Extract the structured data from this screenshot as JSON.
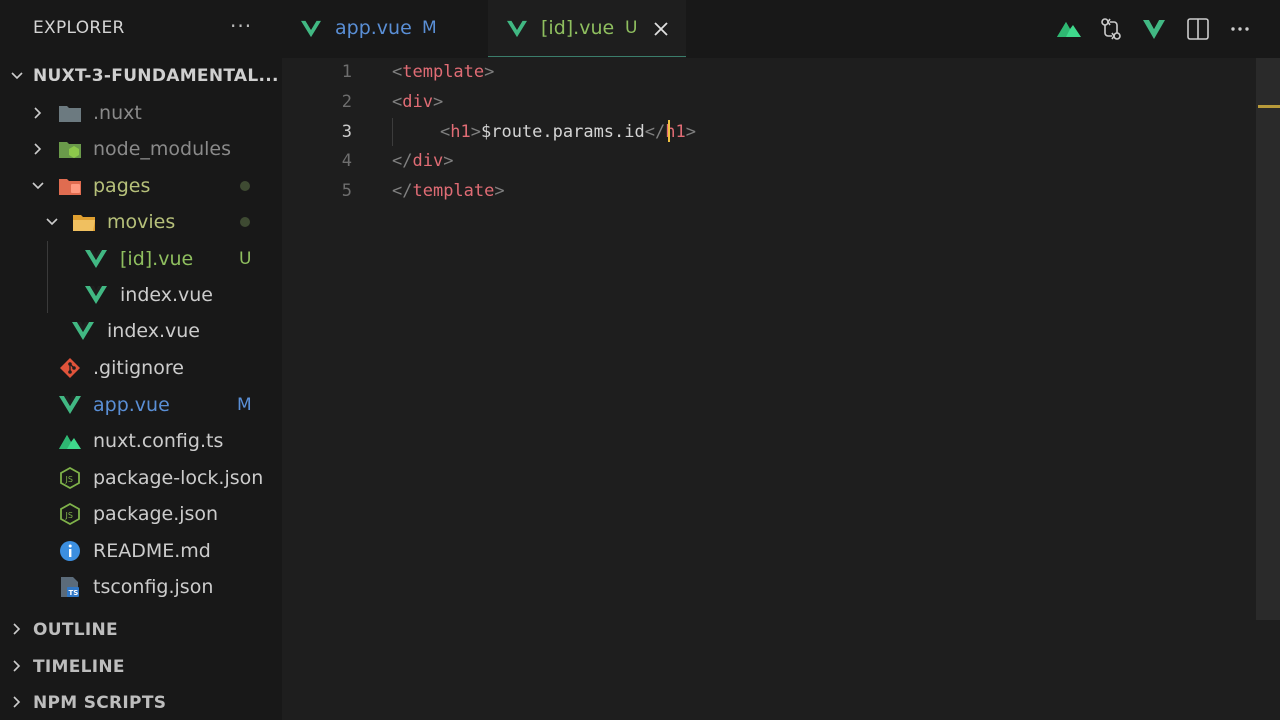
{
  "explorer": {
    "title": "EXPLORER",
    "more": "···",
    "project": "NUXT-3-FUNDAMENTAL...",
    "tree": [
      {
        "name": ".nuxt",
        "color": "#8a8a8a"
      },
      {
        "name": "node_modules",
        "color": "#8a8a8a"
      },
      {
        "name": "pages",
        "color": "#b6c07a"
      },
      {
        "name": "movies",
        "color": "#b6c07a"
      },
      {
        "name": "[id].vue",
        "badge": "U",
        "color": "#8fbf5f"
      },
      {
        "name": "index.vue",
        "color": "#cccccc"
      },
      {
        "name": "index.vue",
        "color": "#cccccc"
      },
      {
        "name": ".gitignore",
        "color": "#cccccc"
      },
      {
        "name": "app.vue",
        "badge": "M",
        "color": "#5a8fd6"
      },
      {
        "name": "nuxt.config.ts",
        "color": "#cccccc"
      },
      {
        "name": "package-lock.json",
        "color": "#cccccc"
      },
      {
        "name": "package.json",
        "color": "#cccccc"
      },
      {
        "name": "README.md",
        "color": "#cccccc"
      },
      {
        "name": "tsconfig.json",
        "color": "#cccccc"
      }
    ],
    "sections": [
      "OUTLINE",
      "TIMELINE",
      "NPM SCRIPTS"
    ]
  },
  "tabs": [
    {
      "label": "app.vue",
      "badge": "M"
    },
    {
      "label": "[id].vue",
      "badge": "U"
    }
  ],
  "editor": {
    "line_numbers": [
      "1",
      "2",
      "3",
      "4",
      "5"
    ],
    "lines": {
      "l1": {
        "open": "<",
        "name": "template",
        "close": ">"
      },
      "l2": {
        "open": "<",
        "name": "div",
        "close": ">"
      },
      "l3": {
        "open": "<",
        "name": "h1",
        "close": ">",
        "text": "$route.params.id",
        "end_open": "</",
        "end_name": "h1",
        "end_close": ">"
      },
      "l4": {
        "open": "</",
        "name": "div",
        "close": ">"
      },
      "l5": {
        "open": "</",
        "name": "template",
        "close": ">"
      }
    }
  },
  "colors": {
    "vue_green": "#41b883",
    "modified": "#5a8fd6",
    "untracked": "#8fbf5f"
  }
}
